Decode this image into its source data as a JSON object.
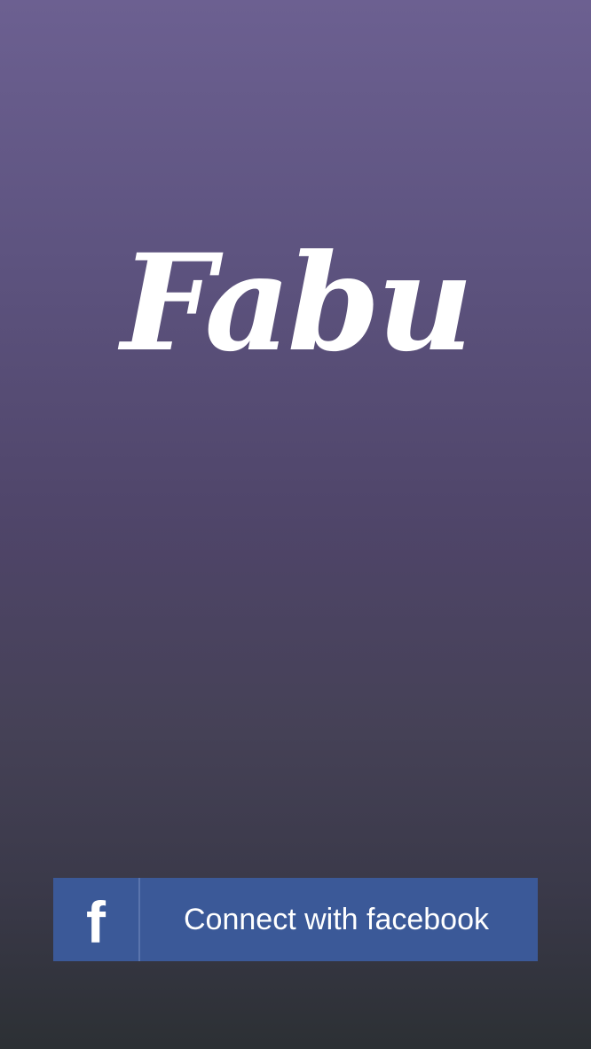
{
  "app": {
    "logo_text": "Fabu"
  },
  "login": {
    "facebook_button_label": "Connect with facebook",
    "facebook_icon": "f"
  },
  "colors": {
    "gradient_top": "#6c6091",
    "gradient_bottom": "#2c3034",
    "facebook_blue": "#3b5998"
  }
}
